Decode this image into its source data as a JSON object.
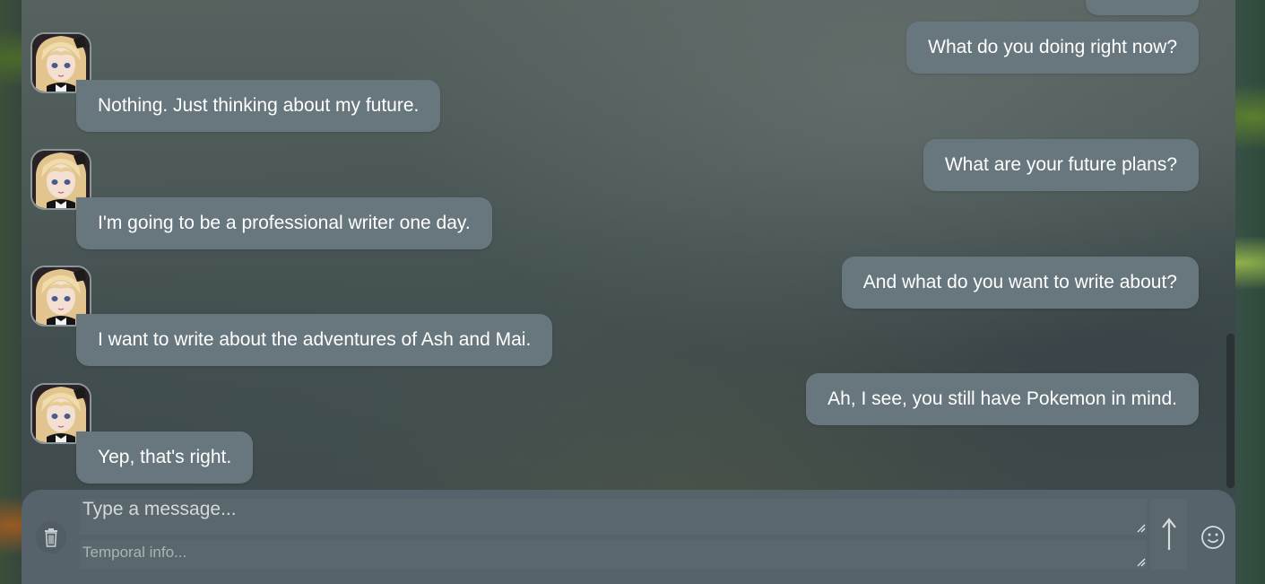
{
  "messages": [
    {
      "role": "user",
      "text": "What do you doing right now?"
    },
    {
      "role": "bot",
      "text": "Nothing. Just thinking about my future."
    },
    {
      "role": "user",
      "text": "What are your future plans?"
    },
    {
      "role": "bot",
      "text": "I'm going to be a professional writer one day."
    },
    {
      "role": "user",
      "text": "And what do you want to write about?"
    },
    {
      "role": "bot",
      "text": "I want to write about the adventures of Ash and Mai."
    },
    {
      "role": "user",
      "text": "Ah, I see, you still have Pokemon in mind."
    },
    {
      "role": "bot",
      "text": "Yep, that's right."
    }
  ],
  "composer": {
    "message_placeholder": "Type a message...",
    "temporal_placeholder": "Temporal info...",
    "send_icon": "up-arrow-icon",
    "emoji_icon": "smiley-icon",
    "clear_icon": "trash-icon"
  },
  "colors": {
    "bubble": "#67777d",
    "composer": "#56636a",
    "text": "#ffffff"
  }
}
